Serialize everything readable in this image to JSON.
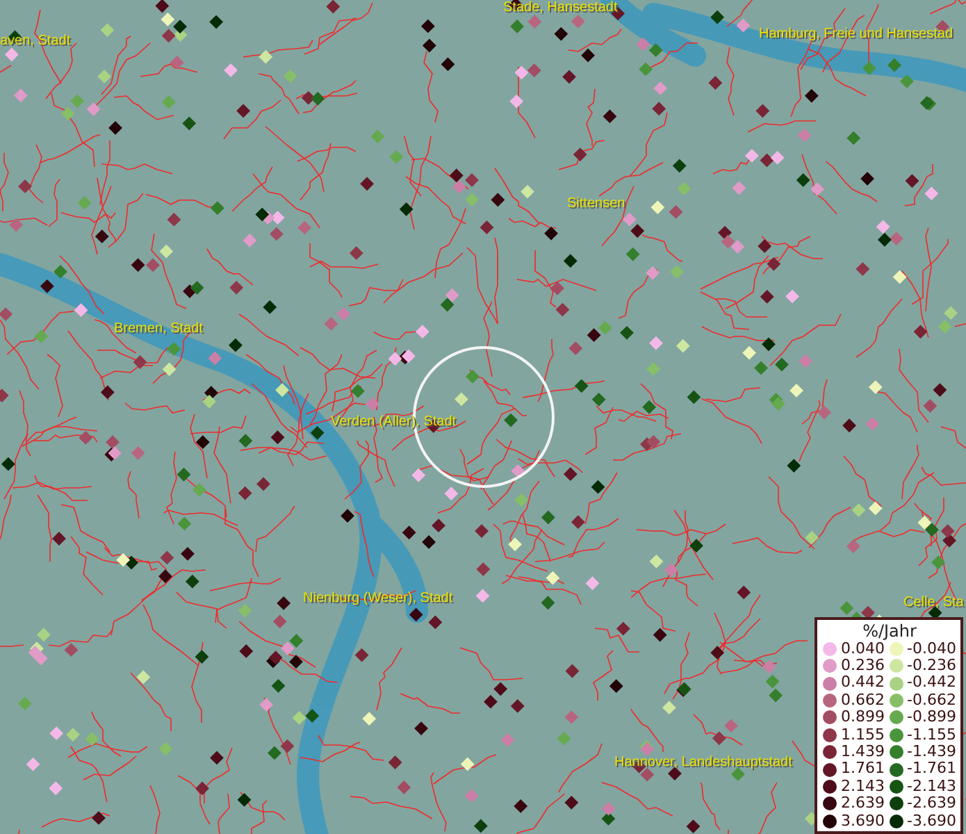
{
  "map": {
    "places": [
      {
        "name": "aven, Stadt"
      },
      {
        "name": "Stade, Hansestadt"
      },
      {
        "name": "Hamburg, Freie und Hansestad"
      },
      {
        "name": "Sittensen"
      },
      {
        "name": "Bremen, Stadt"
      },
      {
        "name": "Verden (Aller), Stadt"
      },
      {
        "name": "Nienburg (Weser), Stadt"
      },
      {
        "name": "Celle, Sta"
      },
      {
        "name": "Hannover, Landeshauptstadt"
      }
    ]
  },
  "legend": {
    "title": "%/Jahr",
    "rows": [
      {
        "positive": {
          "value": "0.040",
          "color": "#f4b8e8"
        },
        "negative": {
          "value": "-0.040",
          "color": "#eef5b8"
        }
      },
      {
        "positive": {
          "value": "0.236",
          "color": "#e09bc8"
        },
        "negative": {
          "value": "-0.236",
          "color": "#cde6a0"
        }
      },
      {
        "positive": {
          "value": "0.442",
          "color": "#cc7fa6"
        },
        "negative": {
          "value": "-0.442",
          "color": "#a9d283"
        }
      },
      {
        "positive": {
          "value": "0.662",
          "color": "#b8667f"
        },
        "negative": {
          "value": "-0.662",
          "color": "#86bf68"
        }
      },
      {
        "positive": {
          "value": "0.899",
          "color": "#a34d63"
        },
        "negative": {
          "value": "-0.899",
          "color": "#66aa4f"
        }
      },
      {
        "positive": {
          "value": "1.155",
          "color": "#8e3748"
        },
        "negative": {
          "value": "-1.155",
          "color": "#4a953b"
        }
      },
      {
        "positive": {
          "value": "1.439",
          "color": "#7a2535"
        },
        "negative": {
          "value": "-1.439",
          "color": "#347f2b"
        }
      },
      {
        "positive": {
          "value": "1.761",
          "color": "#641626"
        },
        "negative": {
          "value": "-1.761",
          "color": "#23691f"
        }
      },
      {
        "positive": {
          "value": "2.143",
          "color": "#4e0c18"
        },
        "negative": {
          "value": "-2.143",
          "color": "#165414"
        }
      },
      {
        "positive": {
          "value": "2.639",
          "color": "#38060f"
        },
        "negative": {
          "value": "-2.639",
          "color": "#0c3f0c"
        }
      },
      {
        "positive": {
          "value": "3.690",
          "color": "#220306"
        },
        "negative": {
          "value": "-3.690",
          "color": "#052a06"
        }
      }
    ]
  }
}
